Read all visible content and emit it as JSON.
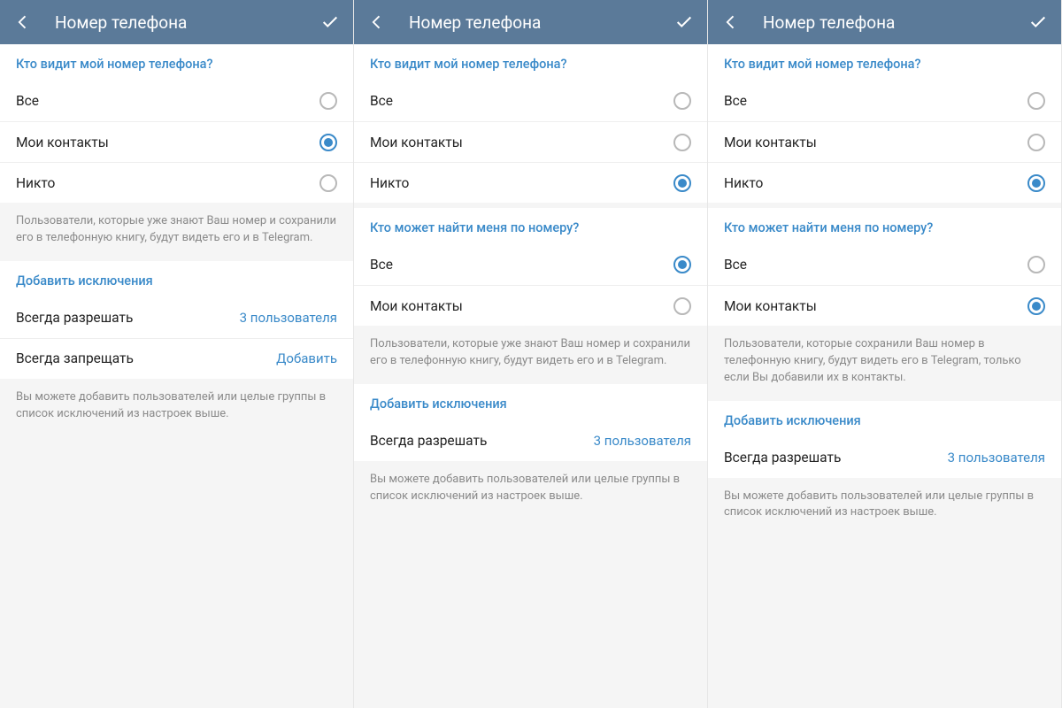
{
  "header": {
    "title": "Номер телефона"
  },
  "panels": [
    {
      "sect1": {
        "title": "Кто видит мой номер телефона?",
        "opts": [
          "Все",
          "Мои контакты",
          "Никто"
        ],
        "selected": 1
      },
      "note1": "Пользователи, которые уже знают Ваш номер и сохранили его в телефонную книгу, будут видеть его и в Telegram.",
      "sectEx": {
        "title": "Добавить исключения",
        "rows": [
          {
            "label": "Всегда разрешать",
            "value": "3 пользователя"
          },
          {
            "label": "Всегда запрещать",
            "value": "Добавить"
          }
        ]
      },
      "note2": "Вы можете добавить пользователей или целые группы в список исключений из настроек выше."
    },
    {
      "sect1": {
        "title": "Кто видит мой номер телефона?",
        "opts": [
          "Все",
          "Мои контакты",
          "Никто"
        ],
        "selected": 2
      },
      "sect2": {
        "title": "Кто может найти меня по номеру?",
        "opts": [
          "Все",
          "Мои контакты"
        ],
        "selected": 0
      },
      "note1": "Пользователи, которые уже знают Ваш номер и сохранили его в телефонную книгу, будут видеть его и в Telegram.",
      "sectEx": {
        "title": "Добавить исключения",
        "rows": [
          {
            "label": "Всегда разрешать",
            "value": "3 пользователя"
          }
        ]
      },
      "note2": "Вы можете добавить пользователей или целые группы в список исключений из настроек выше."
    },
    {
      "sect1": {
        "title": "Кто видит мой номер телефона?",
        "opts": [
          "Все",
          "Мои контакты",
          "Никто"
        ],
        "selected": 2
      },
      "sect2": {
        "title": "Кто может найти меня по номеру?",
        "opts": [
          "Все",
          "Мои контакты"
        ],
        "selected": 1
      },
      "note1": "Пользователи, которые сохранили Ваш номер в телефонную книгу, будут видеть его в Telegram, только если Вы добавили их в контакты.",
      "sectEx": {
        "title": "Добавить исключения",
        "rows": [
          {
            "label": "Всегда разрешать",
            "value": "3 пользователя"
          }
        ]
      },
      "note2": "Вы можете добавить пользователей или целые группы в список исключений из настроек выше."
    }
  ]
}
